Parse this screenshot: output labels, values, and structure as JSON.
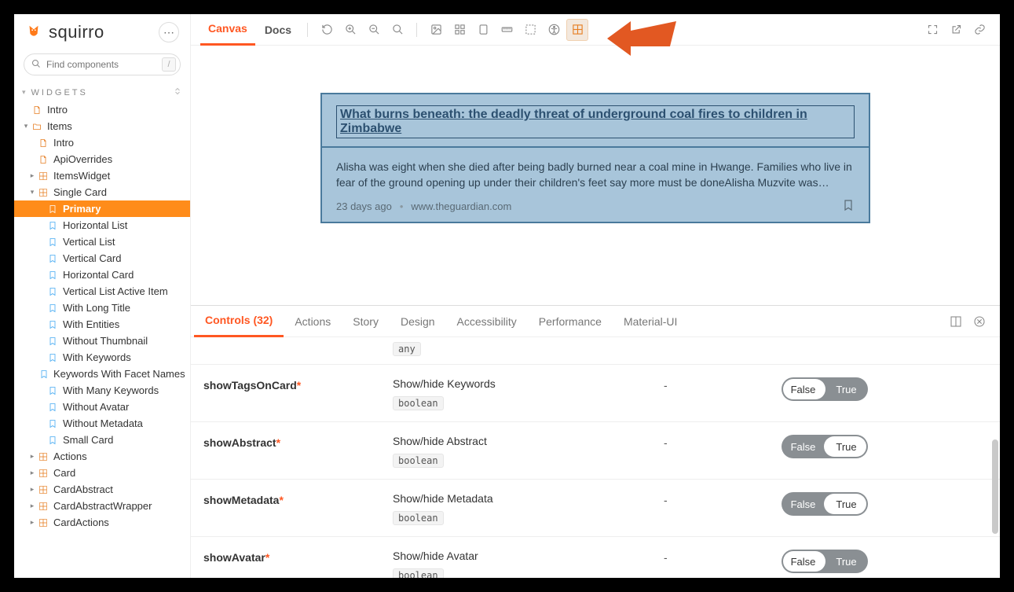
{
  "brand": {
    "name": "squirro"
  },
  "search": {
    "placeholder": "Find components",
    "slash": "/"
  },
  "sections": {
    "widgets_label": "WIDGETS"
  },
  "tree_items": [
    {
      "label": "Intro",
      "level": 0,
      "icon": "doc",
      "caret": ""
    },
    {
      "label": "Items",
      "level": 0,
      "icon": "folder",
      "caret": "▾"
    },
    {
      "label": "Intro",
      "level": 1,
      "icon": "doc",
      "caret": ""
    },
    {
      "label": "ApiOverrides",
      "level": 1,
      "icon": "doc",
      "caret": ""
    },
    {
      "label": "ItemsWidget",
      "level": 1,
      "icon": "comp",
      "caret": "▸"
    },
    {
      "label": "Single Card",
      "level": 1,
      "icon": "comp",
      "caret": "▾"
    },
    {
      "label": "Primary",
      "level": 2,
      "icon": "story",
      "caret": "",
      "selected": true
    },
    {
      "label": "Horizontal List",
      "level": 2,
      "icon": "story",
      "caret": ""
    },
    {
      "label": "Vertical List",
      "level": 2,
      "icon": "story",
      "caret": ""
    },
    {
      "label": "Vertical Card",
      "level": 2,
      "icon": "story",
      "caret": ""
    },
    {
      "label": "Horizontal Card",
      "level": 2,
      "icon": "story",
      "caret": ""
    },
    {
      "label": "Vertical List Active Item",
      "level": 2,
      "icon": "story",
      "caret": ""
    },
    {
      "label": "With Long Title",
      "level": 2,
      "icon": "story",
      "caret": ""
    },
    {
      "label": "With Entities",
      "level": 2,
      "icon": "story",
      "caret": ""
    },
    {
      "label": "Without Thumbnail",
      "level": 2,
      "icon": "story",
      "caret": ""
    },
    {
      "label": "With Keywords",
      "level": 2,
      "icon": "story",
      "caret": ""
    },
    {
      "label": "Keywords With Facet Names",
      "level": 2,
      "icon": "story",
      "caret": ""
    },
    {
      "label": "With Many Keywords",
      "level": 2,
      "icon": "story",
      "caret": ""
    },
    {
      "label": "Without Avatar",
      "level": 2,
      "icon": "story",
      "caret": ""
    },
    {
      "label": "Without Metadata",
      "level": 2,
      "icon": "story",
      "caret": ""
    },
    {
      "label": "Small Card",
      "level": 2,
      "icon": "story",
      "caret": ""
    },
    {
      "label": "Actions",
      "level": 1,
      "icon": "comp",
      "caret": "▸"
    },
    {
      "label": "Card",
      "level": 1,
      "icon": "comp",
      "caret": "▸"
    },
    {
      "label": "CardAbstract",
      "level": 1,
      "icon": "comp",
      "caret": "▸"
    },
    {
      "label": "CardAbstractWrapper",
      "level": 1,
      "icon": "comp",
      "caret": "▸"
    },
    {
      "label": "CardActions",
      "level": 1,
      "icon": "comp",
      "caret": "▸"
    }
  ],
  "toolbar": {
    "tab_canvas": "Canvas",
    "tab_docs": "Docs"
  },
  "card": {
    "title": "What burns beneath: the deadly threat of underground coal fires to children in Zimbabwe",
    "abstract": "Alisha was eight when she died after being badly burned near a coal mine in Hwange. Families who live in fear of the ground opening up under their children's feet say more must be doneAlisha Muzvite was…",
    "age": "23 days ago",
    "source": "www.theguardian.com"
  },
  "panel": {
    "tabs": {
      "controls": "Controls (32)",
      "actions": "Actions",
      "story": "Story",
      "design": "Design",
      "accessibility": "Accessibility",
      "performance": "Performance",
      "material": "Material-UI"
    },
    "stub_type": "any",
    "controls": [
      {
        "name": "showTagsOnCard",
        "required": true,
        "desc": "Show/hide Keywords",
        "type": "boolean",
        "default": "-",
        "value": "False"
      },
      {
        "name": "showAbstract",
        "required": true,
        "desc": "Show/hide Abstract",
        "type": "boolean",
        "default": "-",
        "value": "True"
      },
      {
        "name": "showMetadata",
        "required": true,
        "desc": "Show/hide Metadata",
        "type": "boolean",
        "default": "-",
        "value": "True"
      },
      {
        "name": "showAvatar",
        "required": true,
        "desc": "Show/hide Avatar",
        "type": "boolean",
        "default": "-",
        "value": "False"
      }
    ],
    "toggle_labels": {
      "f": "False",
      "t": "True"
    }
  }
}
